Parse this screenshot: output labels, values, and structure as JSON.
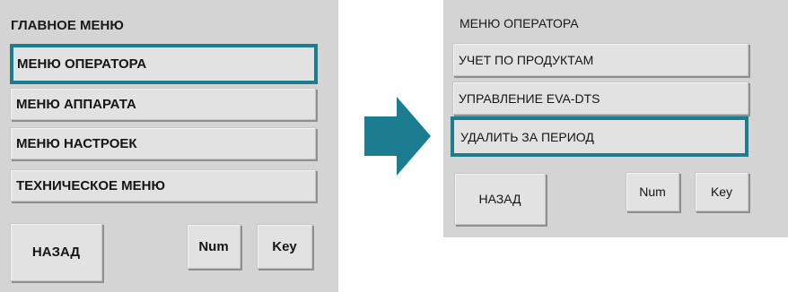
{
  "main_menu": {
    "title": "ГЛАВНОЕ МЕНЮ",
    "items": [
      {
        "label": "МЕНЮ ОПЕРАТОРА",
        "selected": true
      },
      {
        "label": "МЕНЮ АППАРАТА"
      },
      {
        "label": "МЕНЮ НАСТРОЕК"
      },
      {
        "label": "ТЕХНИЧЕСКОЕ МЕНЮ"
      }
    ],
    "back_label": "НАЗАД",
    "num_label": "Num",
    "key_label": "Key"
  },
  "operator_menu": {
    "title": "МЕНЮ ОПЕРАТОРА",
    "items": [
      {
        "label": "УЧЕТ ПО ПРОДУКТАМ"
      },
      {
        "label": "УПРАВЛЕНИЕ EVA-DTS"
      },
      {
        "label": "УДАЛИТЬ ЗА ПЕРИОД",
        "selected": true
      }
    ],
    "back_label": "НАЗАД",
    "num_label": "Num",
    "key_label": "Key"
  },
  "colors": {
    "panel_bg": "#d4d4d4",
    "button_bg": "#e2e2e2",
    "selection_border": "#1c7d8f",
    "arrow": "#1b7d8f"
  },
  "icons": {
    "transition": "arrow-right-icon"
  }
}
